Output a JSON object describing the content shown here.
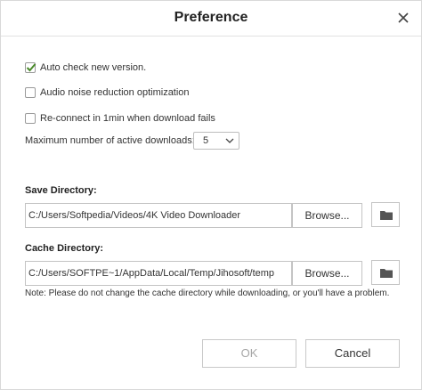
{
  "dialog": {
    "title": "Preference",
    "close_icon": "close-icon"
  },
  "options": {
    "auto_check": {
      "label": "Auto check new version.",
      "checked": true
    },
    "noise_reduction": {
      "label": "Audio noise reduction optimization",
      "checked": false
    },
    "reconnect": {
      "label": "Re-connect in 1min when download fails",
      "checked": false
    },
    "max_downloads": {
      "label": "Maximum number of active downloads:",
      "value": "5"
    }
  },
  "save_directory": {
    "label": "Save Directory:",
    "path": "C:/Users/Softpedia/Videos/4K Video Downloader",
    "browse_label": "Browse...",
    "folder_icon": "folder-icon"
  },
  "cache_directory": {
    "label": "Cache Directory:",
    "path": "C:/Users/SOFTPE~1/AppData/Local/Temp/Jihosoft/temp",
    "browse_label": "Browse...",
    "folder_icon": "folder-icon"
  },
  "note": "Note: Please do not change the cache directory while downloading, or you'll have a problem.",
  "footer": {
    "ok_label": "OK",
    "cancel_label": "Cancel"
  },
  "colors": {
    "check": "#4a8a2a",
    "ok_disabled_text": "#a6a6a6",
    "folder_icon": "#555555"
  }
}
